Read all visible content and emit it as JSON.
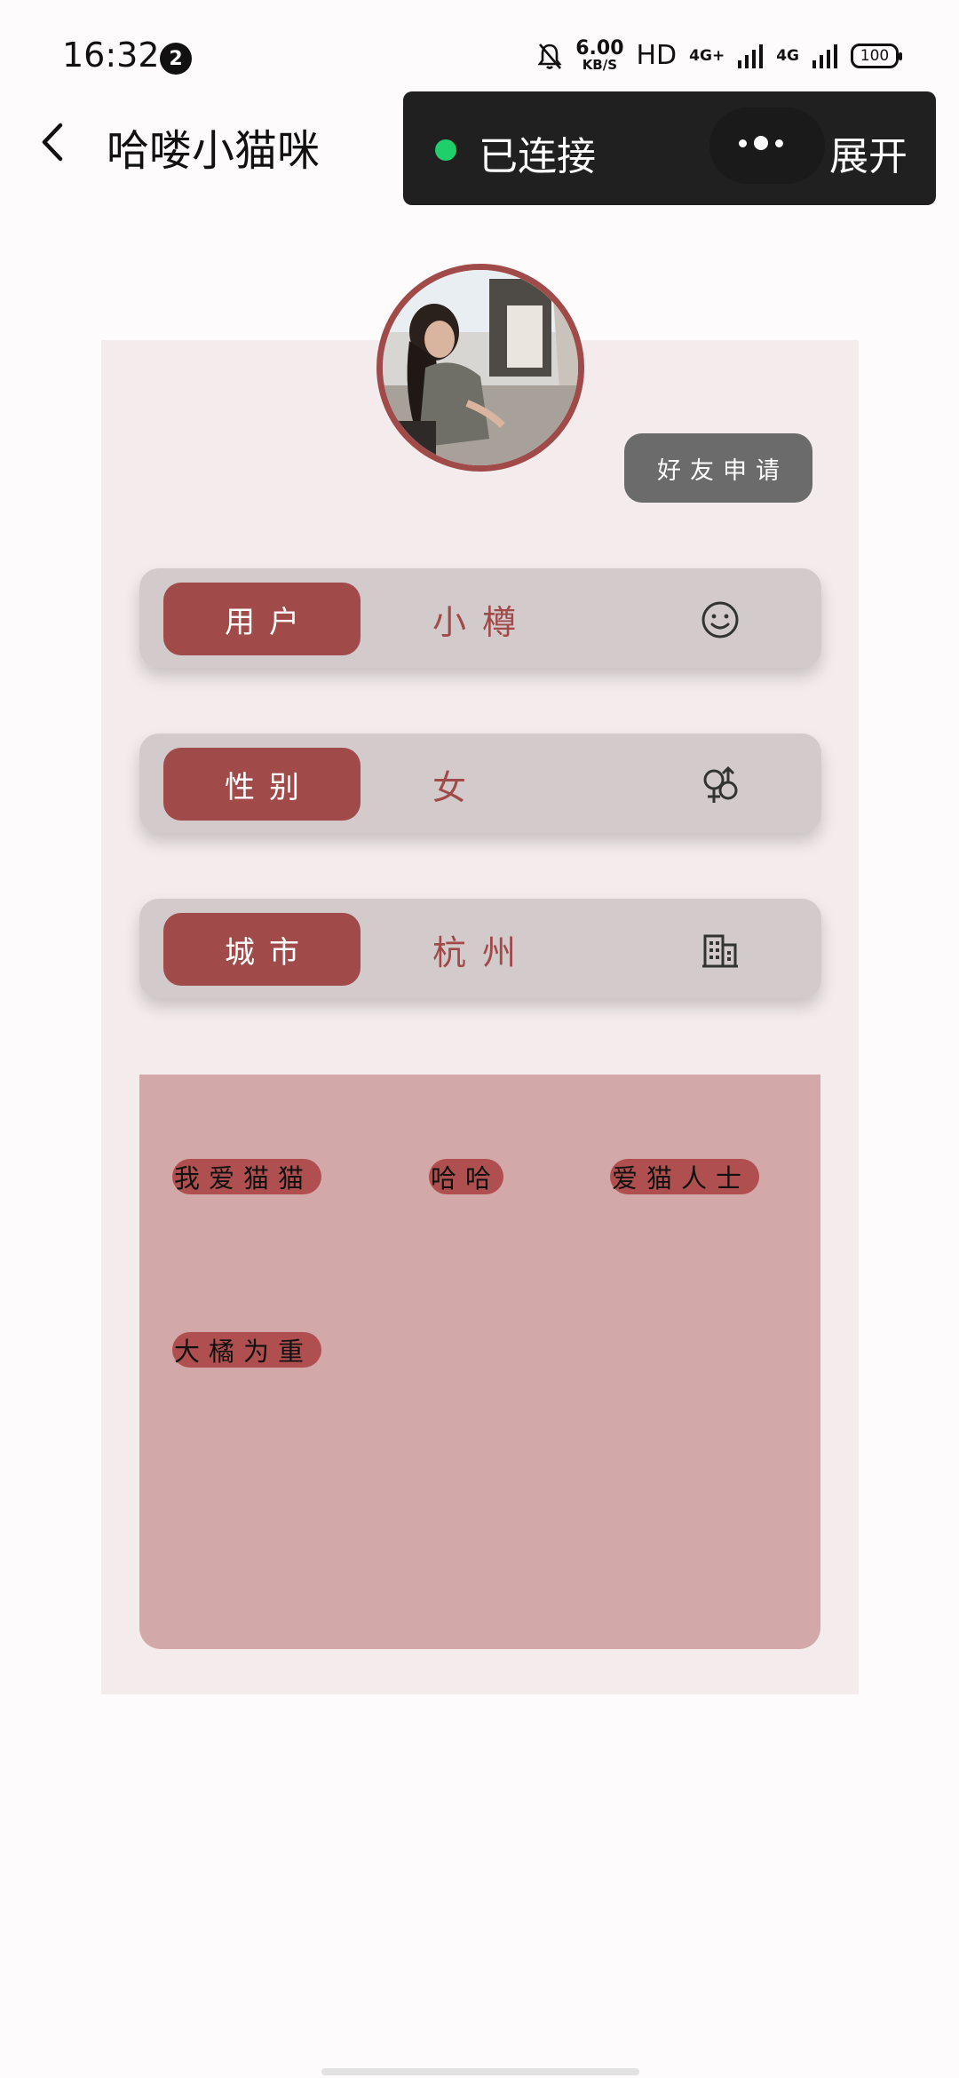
{
  "status_bar": {
    "time": "16:32",
    "notification_count": "2",
    "speed_value": "6.00",
    "speed_unit": "KB/S",
    "hd_label": "HD",
    "net_label_1": "4G+",
    "net_label_2": "4G",
    "battery": "100"
  },
  "header": {
    "title": "哈喽小猫咪"
  },
  "connection": {
    "status": "已连接",
    "expand_label": "展开",
    "status_color": "#1fd06a"
  },
  "profile": {
    "friend_request_label": "好友申请",
    "fields": [
      {
        "label": "用户",
        "value": "小樽",
        "icon": "smiley-icon"
      },
      {
        "label": "性别",
        "value": "女",
        "icon": "gender-icon"
      },
      {
        "label": "城市",
        "value": "杭州",
        "icon": "building-icon"
      }
    ],
    "tags": [
      "我爱猫猫",
      "哈哈",
      "爱猫人士",
      "大橘为重"
    ]
  },
  "colors": {
    "accent": "#a04a4a",
    "card_bg": "#f4ecec",
    "row_bg": "#d3cbcb",
    "tags_bg": "#d3a8a8"
  }
}
